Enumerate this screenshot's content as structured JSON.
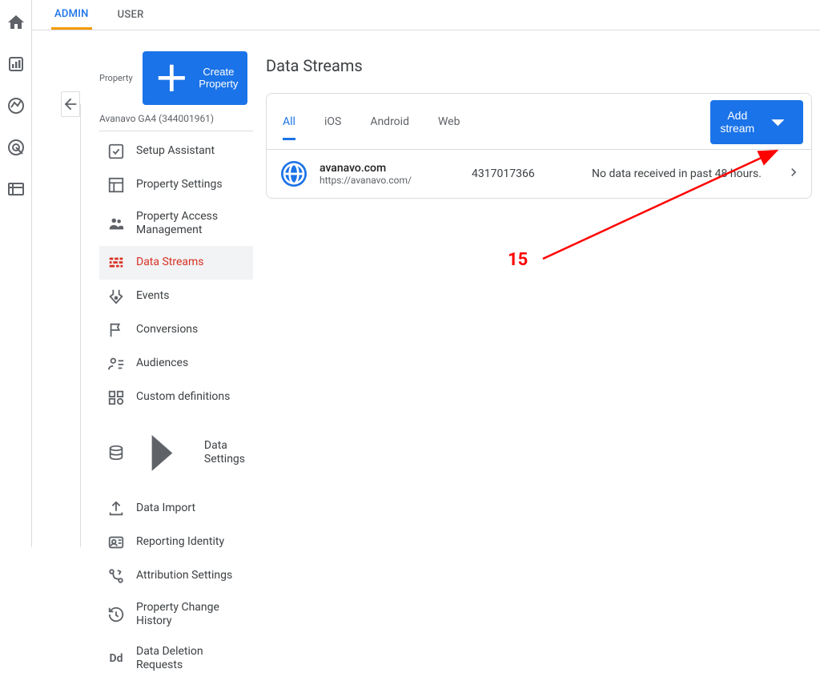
{
  "topTabs": {
    "admin": "ADMIN",
    "user": "USER"
  },
  "property": {
    "label": "Property",
    "createButton": "Create Property",
    "name": "Avanavo GA4 (344001961)"
  },
  "menu": [
    {
      "label": "Setup Assistant",
      "icon": "check-square-icon"
    },
    {
      "label": "Property Settings",
      "icon": "layout-icon"
    },
    {
      "label": "Property Access Management",
      "icon": "people-icon"
    },
    {
      "label": "Data Streams",
      "icon": "data-streams-icon",
      "active": true
    },
    {
      "label": "Events",
      "icon": "events-icon"
    },
    {
      "label": "Conversions",
      "icon": "flag-icon"
    },
    {
      "label": "Audiences",
      "icon": "audiences-icon"
    },
    {
      "label": "Custom definitions",
      "icon": "custom-def-icon"
    },
    {
      "label": "Data Settings",
      "icon": "data-settings-icon",
      "hasSubmenu": true
    },
    {
      "label": "Data Import",
      "icon": "upload-icon"
    },
    {
      "label": "Reporting Identity",
      "icon": "identity-icon"
    },
    {
      "label": "Attribution Settings",
      "icon": "attribution-icon"
    },
    {
      "label": "Property Change History",
      "icon": "history-icon"
    },
    {
      "label": "Data Deletion Requests",
      "icon": "deletion-icon"
    }
  ],
  "page": {
    "title": "Data Streams",
    "filterTabs": {
      "all": "All",
      "ios": "iOS",
      "android": "Android",
      "web": "Web"
    },
    "addButton": "Add stream",
    "stream": {
      "name": "avanavo.com",
      "url": "https://avanavo.com/",
      "id": "4317017366",
      "status": "No data received in past 48 hours."
    }
  },
  "annotation": {
    "number": "15"
  }
}
